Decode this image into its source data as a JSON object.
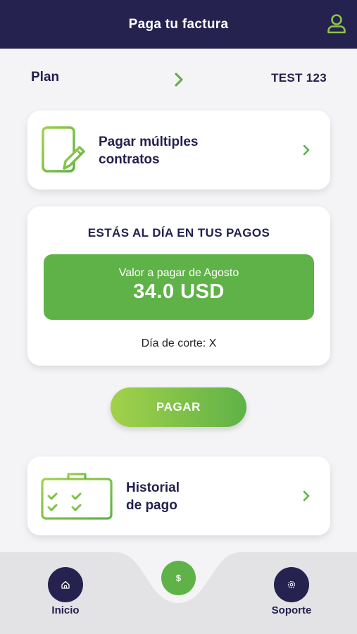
{
  "header": {
    "title": "Paga tu factura",
    "profile_icon": "user-icon"
  },
  "plan": {
    "label": "Plan",
    "value": "TEST 123",
    "chevron_icon": "chevron-right-icon"
  },
  "multi_contracts": {
    "icon": "document-edit-icon",
    "label_line1": "Pagar múltiples",
    "label_line2": "contratos"
  },
  "status": {
    "title": "ESTÁS AL DÍA EN TUS PAGOS",
    "amount_caption": "Valor a pagar de Agosto",
    "amount_value": "34.0 USD",
    "cutoff": "Día de corte: X"
  },
  "pay_button": {
    "label": "PAGAR"
  },
  "history": {
    "icon": "checklist-board-icon",
    "label_line1": "Historial",
    "label_line2": "de pago"
  },
  "bottom_nav": {
    "items": [
      {
        "label": "Inicio",
        "icon": "home-icon"
      },
      {
        "label": "",
        "icon": "dollar-icon",
        "symbol": "$"
      },
      {
        "label": "Soporte",
        "icon": "settings-icon"
      }
    ]
  },
  "colors": {
    "navy": "#25224f",
    "green": "#5fb247",
    "light_green": "#a2d14a",
    "background": "#f4f4f6"
  }
}
